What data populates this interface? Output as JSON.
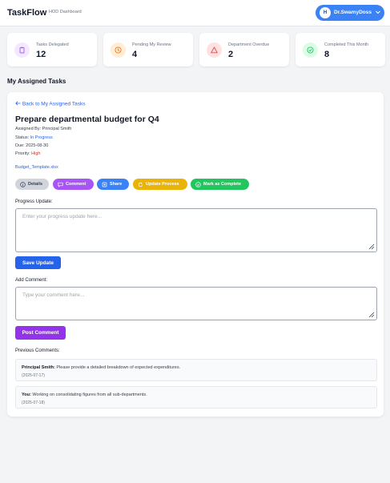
{
  "header": {
    "brand": "TaskFlow",
    "subtitle": "HOD Dashboard",
    "user_initial": "H",
    "user_name": "Dr.SwamyDoss"
  },
  "stats": [
    {
      "label": "Tasks Delegated",
      "value": "12",
      "icon": "clipboard-icon",
      "color": "#a855f7",
      "bg": "#f3e8ff"
    },
    {
      "label": "Pending My Review",
      "value": "4",
      "icon": "clock-icon",
      "color": "#f97316",
      "bg": "#ffedd5"
    },
    {
      "label": "Department Overdue",
      "value": "2",
      "icon": "warning-icon",
      "color": "#ef4444",
      "bg": "#fee2e2"
    },
    {
      "label": "Completed This Month",
      "value": "8",
      "icon": "check-circle-icon",
      "color": "#22c55e",
      "bg": "#dcfce7"
    }
  ],
  "section_title": "My Assigned Tasks",
  "task": {
    "back_label": "Back to My Assigned Tasks",
    "title": "Prepare departmental budget for Q4",
    "assigned_by_label": "Assigned By:",
    "assigned_by": "Principal Smith",
    "status_label": "Status:",
    "status": "In Progress",
    "due_label": "Due:",
    "due": "2025-08-30",
    "priority_label": "Priority:",
    "priority": "High",
    "attachment": "Budget_Template.xlsx"
  },
  "actions": {
    "details": "Details",
    "comment": "Comment",
    "share": "Share",
    "update_process": "Update Process",
    "mark_complete": "Mark as Complete"
  },
  "progress": {
    "label": "Progress Update:",
    "placeholder": "Enter your progress update here...",
    "button": "Save Update"
  },
  "add_comment": {
    "label": "Add Comment:",
    "placeholder": "Type your comment here...",
    "button": "Post Comment"
  },
  "previous_comments": {
    "label": "Previous Comments:",
    "items": [
      {
        "author": "Principal Smith:",
        "text": "Please provide a detailed breakdown of expected expenditures.",
        "date": "(2025-07-17)"
      },
      {
        "author": "You:",
        "text": "Working on consolidating figures from all sub-departments.",
        "date": "(2025-07-18)"
      }
    ]
  },
  "colors": {
    "primary_blue": "#2563eb",
    "purple": "#9333ea",
    "share_blue": "#3b82f6",
    "amber": "#eab308",
    "green": "#22c55e",
    "danger": "#dc2626"
  }
}
